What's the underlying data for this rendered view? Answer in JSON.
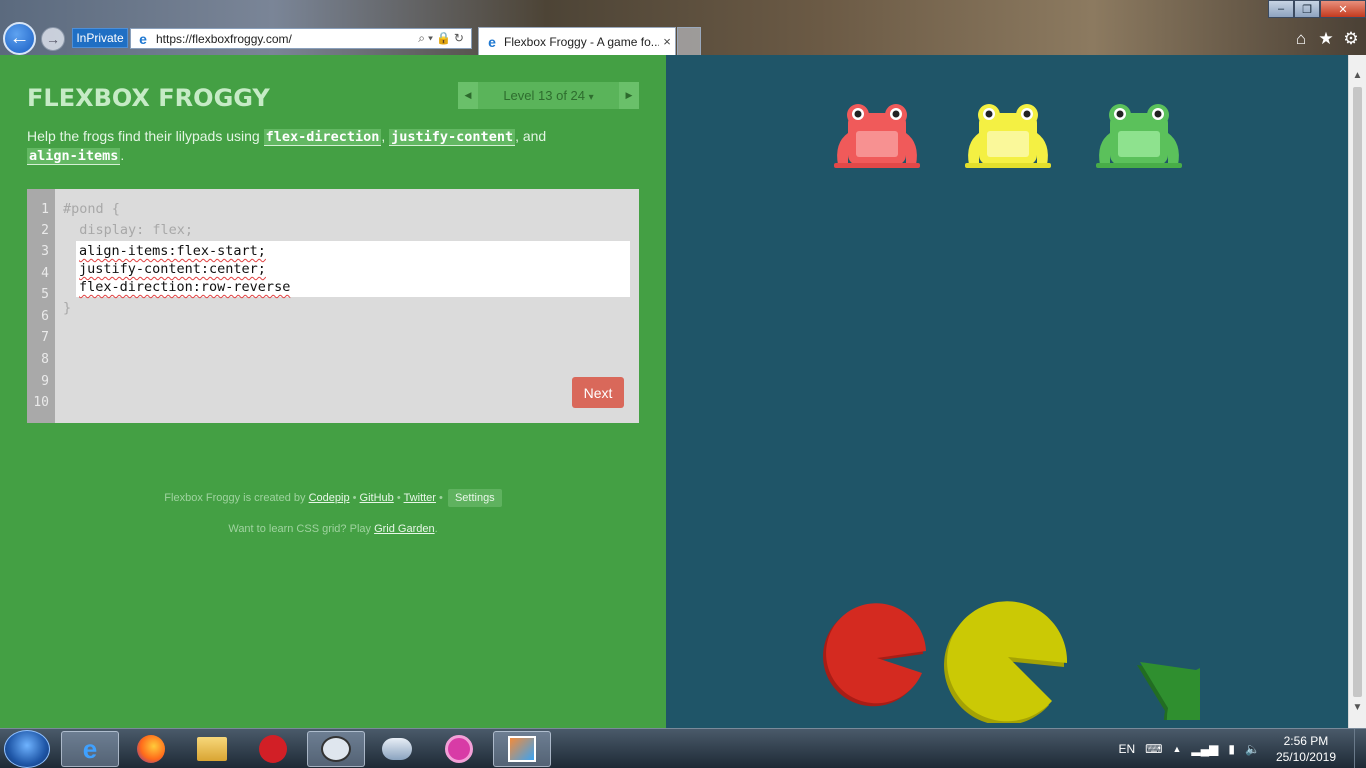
{
  "browser": {
    "inprivate_label": "InPrivate",
    "url": "https://flexboxfroggy.com/",
    "tab_title": "Flexbox Froggy - A game fo...",
    "tab_close": "×",
    "back_glyph": "←",
    "forward_glyph": "→",
    "address_tools": "⌕▾🔒↻",
    "window_controls": {
      "minimize": "–",
      "maximize": "❐",
      "close": "✕"
    },
    "toolbar_icons": {
      "home": "⌂",
      "favorites": "★",
      "settings": "⚙"
    }
  },
  "game": {
    "logo": "FLEXBOX FROGGY",
    "level": {
      "label": "Level 13 of 24",
      "dropdown": "▾",
      "prev": "◀",
      "next": "▶"
    },
    "instructions": {
      "prefix": "Help the frogs find their lilypads using ",
      "prop1": "flex-direction",
      "sep1": ", ",
      "prop2": "justify-content",
      "sep2": ", and ",
      "prop3": "align-items",
      "suffix": "."
    },
    "editor": {
      "line_numbers": [
        "1",
        "2",
        "3",
        "4",
        "5",
        "6",
        "7",
        "8",
        "9",
        "10"
      ],
      "line1": "#pond {",
      "line2": "  display: flex;",
      "input_lines": [
        "align-items:flex-start;",
        "justify-content:center;",
        "flex-direction:row-reverse"
      ],
      "closing": "}",
      "next_button": "Next"
    },
    "credits": {
      "text": "Flexbox Froggy is created by ",
      "codepip": "Codepip",
      "bullet1": " • ",
      "github": "GitHub",
      "bullet2": " • ",
      "twitter": "Twitter",
      "bullet3": " • ",
      "settings": "Settings"
    },
    "promo": {
      "text": "Want to learn CSS grid? Play ",
      "link": "Grid Garden",
      "suffix": "."
    }
  },
  "pond": {
    "frogs": [
      {
        "color": "red",
        "hex": "#f05a5a"
      },
      {
        "color": "yellow",
        "hex": "#f4f043"
      },
      {
        "color": "green",
        "hex": "#5bc15b"
      }
    ],
    "lilypads": [
      {
        "color": "red",
        "hex": "#d42a20"
      },
      {
        "color": "yellow",
        "hex": "#cbc905"
      },
      {
        "color": "green",
        "hex": "#2f8f2f"
      }
    ],
    "background": "#1f5568"
  },
  "taskbar": {
    "apps": [
      "internet-explorer",
      "firefox",
      "file-explorer",
      "trend-micro",
      "keyboard-app",
      "weather-app",
      "media-app",
      "paint-app"
    ],
    "language": "EN",
    "time": "2:56 PM",
    "date": "25/10/2019"
  }
}
